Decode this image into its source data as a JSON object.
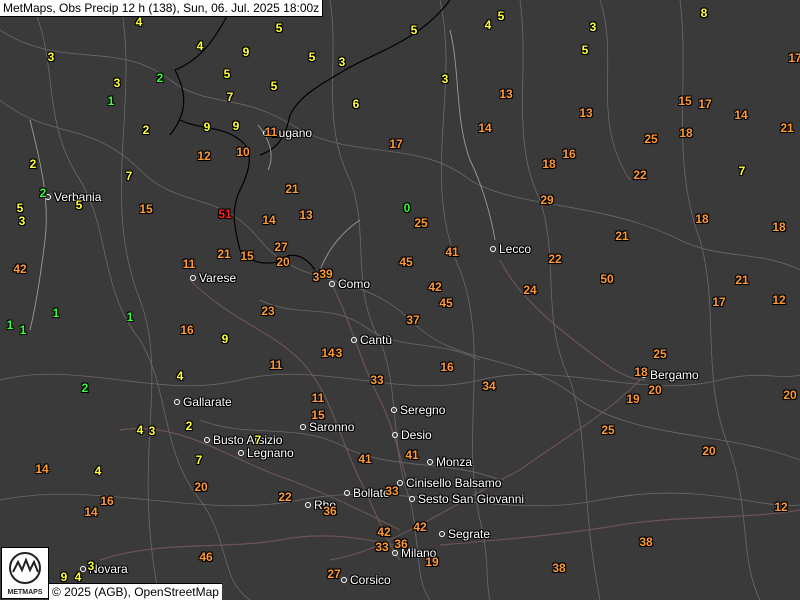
{
  "header": {
    "title": "MetMaps, Obs Precip 12 h (138), Sun, 06. Jul. 2025 18:00z"
  },
  "attribution": "© 2025 (AGB), OpenStreetMap",
  "logo": {
    "icon": "metmaps-logo-icon",
    "text": "METMAPS"
  },
  "colors": {
    "low": "#ffff33",
    "light": "#33ff33",
    "mid": "#ff9933",
    "high": "#ff2020",
    "zero": "#33ff33"
  },
  "cities": [
    {
      "name": "Verbania"
    },
    {
      "name": "Lugano"
    },
    {
      "name": "Lecco"
    },
    {
      "name": "Varese"
    },
    {
      "name": "Como"
    },
    {
      "name": "Cantù"
    },
    {
      "name": "Bergamo"
    },
    {
      "name": "Gallarate"
    },
    {
      "name": "Seregno"
    },
    {
      "name": "Saronno"
    },
    {
      "name": "Busto Arsizio"
    },
    {
      "name": "Desio"
    },
    {
      "name": "Legnano"
    },
    {
      "name": "Monza"
    },
    {
      "name": "Cinisello Balsamo"
    },
    {
      "name": "Bollate"
    },
    {
      "name": "Sesto San Giovanni"
    },
    {
      "name": "Rho"
    },
    {
      "name": "Segrate"
    },
    {
      "name": "Milano"
    },
    {
      "name": "Novara"
    },
    {
      "name": "Corsico"
    }
  ],
  "observations": [
    {
      "v": "4",
      "c": "low"
    },
    {
      "v": "3",
      "c": "low"
    },
    {
      "v": "4",
      "c": "low"
    },
    {
      "v": "9",
      "c": "low"
    },
    {
      "v": "5",
      "c": "low"
    },
    {
      "v": "5",
      "c": "low"
    },
    {
      "v": "4",
      "c": "low"
    },
    {
      "v": "5",
      "c": "low"
    },
    {
      "v": "3",
      "c": "low"
    },
    {
      "v": "5",
      "c": "low"
    },
    {
      "v": "8",
      "c": "low"
    },
    {
      "v": "3",
      "c": "low"
    },
    {
      "v": "2",
      "c": "light"
    },
    {
      "v": "5",
      "c": "low"
    },
    {
      "v": "5",
      "c": "low"
    },
    {
      "v": "7",
      "c": "low"
    },
    {
      "v": "17",
      "c": "mid"
    },
    {
      "v": "3",
      "c": "low"
    },
    {
      "v": "1",
      "c": "light"
    },
    {
      "v": "5",
      "c": "low"
    },
    {
      "v": "3",
      "c": "low"
    },
    {
      "v": "6",
      "c": "low"
    },
    {
      "v": "13",
      "c": "mid"
    },
    {
      "v": "15",
      "c": "mid"
    },
    {
      "v": "17",
      "c": "mid"
    },
    {
      "v": "14",
      "c": "mid"
    },
    {
      "v": "13",
      "c": "mid"
    },
    {
      "v": "14",
      "c": "mid"
    },
    {
      "v": "21",
      "c": "mid"
    },
    {
      "v": "2",
      "c": "low"
    },
    {
      "v": "9",
      "c": "low"
    },
    {
      "v": "9",
      "c": "low"
    },
    {
      "v": "11",
      "c": "mid"
    },
    {
      "v": "17",
      "c": "mid"
    },
    {
      "v": "18",
      "c": "mid"
    },
    {
      "v": "25",
      "c": "mid"
    },
    {
      "v": "12",
      "c": "mid"
    },
    {
      "v": "10",
      "c": "mid"
    },
    {
      "v": "18",
      "c": "mid"
    },
    {
      "v": "16",
      "c": "mid"
    },
    {
      "v": "2",
      "c": "low"
    },
    {
      "v": "22",
      "c": "mid"
    },
    {
      "v": "7",
      "c": "low"
    },
    {
      "v": "7",
      "c": "low"
    },
    {
      "v": "21",
      "c": "mid"
    },
    {
      "v": "2",
      "c": "light"
    },
    {
      "v": "5",
      "c": "low"
    },
    {
      "v": "5",
      "c": "low"
    },
    {
      "v": "15",
      "c": "mid"
    },
    {
      "v": "29",
      "c": "mid"
    },
    {
      "v": "0",
      "c": "zero"
    },
    {
      "v": "3",
      "c": "low"
    },
    {
      "v": "51",
      "c": "high"
    },
    {
      "v": "14",
      "c": "mid"
    },
    {
      "v": "13",
      "c": "mid"
    },
    {
      "v": "25",
      "c": "mid"
    },
    {
      "v": "18",
      "c": "mid"
    },
    {
      "v": "18",
      "c": "mid"
    },
    {
      "v": "27",
      "c": "mid"
    },
    {
      "v": "41",
      "c": "mid"
    },
    {
      "v": "21",
      "c": "mid"
    },
    {
      "v": "21",
      "c": "mid"
    },
    {
      "v": "15",
      "c": "mid"
    },
    {
      "v": "20",
      "c": "mid"
    },
    {
      "v": "45",
      "c": "mid"
    },
    {
      "v": "22",
      "c": "mid"
    },
    {
      "v": "42",
      "c": "mid"
    },
    {
      "v": "11",
      "c": "mid"
    },
    {
      "v": "3",
      "c": "mid"
    },
    {
      "v": "39",
      "c": "mid"
    },
    {
      "v": "50",
      "c": "mid"
    },
    {
      "v": "21",
      "c": "mid"
    },
    {
      "v": "42",
      "c": "mid"
    },
    {
      "v": "24",
      "c": "mid"
    },
    {
      "v": "45",
      "c": "mid"
    },
    {
      "v": "17",
      "c": "mid"
    },
    {
      "v": "12",
      "c": "mid"
    },
    {
      "v": "1",
      "c": "light"
    },
    {
      "v": "1",
      "c": "light"
    },
    {
      "v": "1",
      "c": "light"
    },
    {
      "v": "23",
      "c": "mid"
    },
    {
      "v": "1",
      "c": "light"
    },
    {
      "v": "37",
      "c": "mid"
    },
    {
      "v": "16",
      "c": "mid"
    },
    {
      "v": "9",
      "c": "low"
    },
    {
      "v": "14",
      "c": "mid"
    },
    {
      "v": "3",
      "c": "mid"
    },
    {
      "v": "25",
      "c": "mid"
    },
    {
      "v": "11",
      "c": "mid"
    },
    {
      "v": "16",
      "c": "mid"
    },
    {
      "v": "4",
      "c": "low"
    },
    {
      "v": "33",
      "c": "mid"
    },
    {
      "v": "34",
      "c": "mid"
    },
    {
      "v": "18",
      "c": "mid"
    },
    {
      "v": "2",
      "c": "light"
    },
    {
      "v": "11",
      "c": "mid"
    },
    {
      "v": "19",
      "c": "mid"
    },
    {
      "v": "20",
      "c": "mid"
    },
    {
      "v": "20",
      "c": "mid"
    },
    {
      "v": "15",
      "c": "mid"
    },
    {
      "v": "4",
      "c": "low"
    },
    {
      "v": "3",
      "c": "low"
    },
    {
      "v": "2",
      "c": "low"
    },
    {
      "v": "7",
      "c": "low"
    },
    {
      "v": "25",
      "c": "mid"
    },
    {
      "v": "7",
      "c": "low"
    },
    {
      "v": "41",
      "c": "mid"
    },
    {
      "v": "41",
      "c": "mid"
    },
    {
      "v": "20",
      "c": "mid"
    },
    {
      "v": "14",
      "c": "mid"
    },
    {
      "v": "4",
      "c": "low"
    },
    {
      "v": "20",
      "c": "mid"
    },
    {
      "v": "33",
      "c": "mid"
    },
    {
      "v": "16",
      "c": "mid"
    },
    {
      "v": "22",
      "c": "mid"
    },
    {
      "v": "36",
      "c": "mid"
    },
    {
      "v": "14",
      "c": "mid"
    },
    {
      "v": "42",
      "c": "mid"
    },
    {
      "v": "42",
      "c": "mid"
    },
    {
      "v": "12",
      "c": "mid"
    },
    {
      "v": "33",
      "c": "mid"
    },
    {
      "v": "36",
      "c": "mid"
    },
    {
      "v": "38",
      "c": "mid"
    },
    {
      "v": "46",
      "c": "mid"
    },
    {
      "v": "19",
      "c": "mid"
    },
    {
      "v": "3",
      "c": "low"
    },
    {
      "v": "4",
      "c": "low"
    },
    {
      "v": "9",
      "c": "low"
    },
    {
      "v": "27",
      "c": "mid"
    },
    {
      "v": "38",
      "c": "mid"
    }
  ]
}
